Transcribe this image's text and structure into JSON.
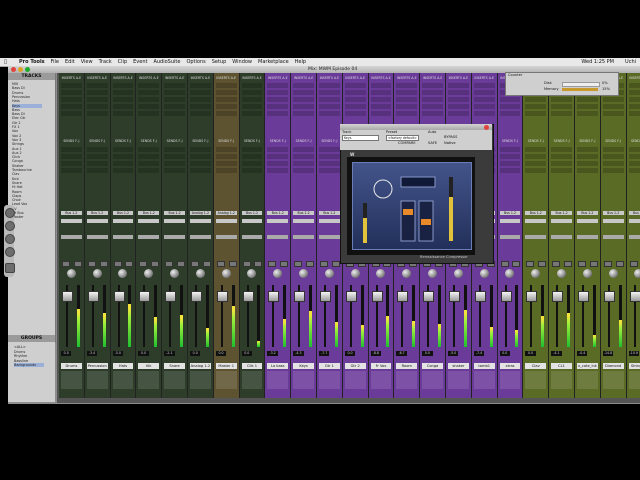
{
  "menu": {
    "app_name": "Pro Tools",
    "items": [
      "File",
      "Edit",
      "View",
      "Track",
      "Clip",
      "Event",
      "AudioSuite",
      "Options",
      "Setup",
      "Window",
      "Marketplace",
      "Help"
    ],
    "clock": "Wed 1:25 PM",
    "user": "Uchi"
  },
  "window": {
    "title": "Mix: MWM Episode 04"
  },
  "tracks_panel": {
    "title": "TRACKS",
    "rows": [
      "MIX",
      "Bass DI",
      "Drums",
      "Percussion",
      "Hats",
      "Keys",
      "Bass",
      "Bass DI",
      "Elec Gtr",
      "Gtr 2",
      "FX 1",
      "Vox",
      "Vox 2",
      "Vox 3",
      "Strings",
      "Aux 1",
      "Aux 2",
      "Click",
      "Conga",
      "Shaker",
      "Tambourine",
      "Clav",
      "Kick",
      "Snare",
      "Hi Hat",
      "Room",
      "Claps",
      "Choir",
      "Lead Vox",
      "BV",
      "FX Bus",
      "Master"
    ],
    "selected_index": 5
  },
  "groups_panel": {
    "title": "GROUPS",
    "rows": [
      "<ALL>",
      "Drums",
      "Rhythm",
      "Bassline",
      "Backgrounds"
    ],
    "selected_index": 4
  },
  "strips": [
    {
      "name": "Drums",
      "color": "#2d3d2a",
      "insert": "INSERTS A-E",
      "send": "SENDS F-J",
      "output": "Bus 1-2",
      "vol": "0.0",
      "meter": 0.62
    },
    {
      "name": "Percussion",
      "color": "#2d3d2a",
      "insert": "INSERTS A-E",
      "send": "SENDS F-J",
      "output": "Bus 1-2",
      "vol": "-3.4",
      "meter": 0.55
    },
    {
      "name": "Hats",
      "color": "#2d3d2a",
      "insert": "INSERTS A-E",
      "send": "SENDS F-J",
      "output": "Bus 1-2",
      "vol": "-5.0",
      "meter": 0.7
    },
    {
      "name": "Kik",
      "color": "#2d3d2a",
      "insert": "INSERTS A-E",
      "send": "SENDS F-J",
      "output": "Bus 1-2",
      "vol": "0.0",
      "meter": 0.48
    },
    {
      "name": "Snare",
      "color": "#2d3d2a",
      "insert": "INSERTS A-E",
      "send": "SENDS F-J",
      "output": "Bus 1-2",
      "vol": "-2.1",
      "meter": 0.52
    },
    {
      "name": "Analog 1-2",
      "color": "#2d3d2a",
      "insert": "INSERTS A-E",
      "send": "SENDS F-J",
      "output": "Analog 1-2",
      "vol": "0.0",
      "meter": 0.3
    },
    {
      "name": "Master 1",
      "color": "#5e5330",
      "insert": "INSERTS A-E",
      "send": "SENDS F-J",
      "output": "Analog 1-2",
      "vol": "0.0",
      "meter": 0.66
    },
    {
      "name": "Clik 1",
      "color": "#2d3d2a",
      "insert": "INSERTS A-E",
      "send": "SENDS F-J",
      "output": "Bus 1-2",
      "vol": "0.0",
      "meter": 0.1
    },
    {
      "name": "Lo bass",
      "color": "#6b3b9a",
      "insert": "INSERTS A-E",
      "send": "SENDS F-J",
      "output": "Bus 1-2",
      "vol": "-3.2",
      "meter": 0.45
    },
    {
      "name": "Keys",
      "color": "#6b3b9a",
      "insert": "INSERTS A-E",
      "send": "SENDS F-J",
      "output": "Bus 1-2",
      "vol": "-4.3",
      "meter": 0.58
    },
    {
      "name": "Gtr 1",
      "color": "#6b3b9a",
      "insert": "INSERTS A-E",
      "send": "SENDS F-J",
      "output": "Bus 1-2",
      "vol": "-7.7",
      "meter": 0.4
    },
    {
      "name": "Gtr 2",
      "color": "#6b3b9a",
      "insert": "INSERTS A-E",
      "send": "SENDS F-J",
      "output": "Bus 1-2",
      "vol": "0.0",
      "meter": 0.35
    },
    {
      "name": "Fr Vox",
      "color": "#6b3b9a",
      "insert": "INSERTS A-E",
      "send": "SENDS F-J",
      "output": "Bus 1-2",
      "vol": "-8.8",
      "meter": 0.5
    },
    {
      "name": "Room",
      "color": "#6b3b9a",
      "insert": "INSERTS A-E",
      "send": "SENDS F-J",
      "output": "Bus 1-2",
      "vol": "-6.7",
      "meter": 0.42
    },
    {
      "name": "Conga",
      "color": "#6b3b9a",
      "insert": "INSERTS A-E",
      "send": "SENDS F-J",
      "output": "Bus 1-2",
      "vol": "0.0",
      "meter": 0.37
    },
    {
      "name": "shaker",
      "color": "#6b3b9a",
      "insert": "INSERTS A-E",
      "send": "SENDS F-J",
      "output": "Bus 1-2",
      "vol": "-5.0",
      "meter": 0.6
    },
    {
      "name": "tamb1",
      "color": "#6b3b9a",
      "insert": "INSERTS A-E",
      "send": "SENDS F-J",
      "output": "Bus 1-2",
      "vol": "-7.4",
      "meter": 0.33
    },
    {
      "name": "xtras",
      "color": "#6b3b9a",
      "insert": "INSERTS A-E",
      "send": "SENDS F-J",
      "output": "Bus 1-2",
      "vol": "0.0",
      "meter": 0.28
    },
    {
      "name": "Clav",
      "color": "#5a6b25",
      "insert": "INSERTS A-E",
      "send": "SENDS F-J",
      "output": "Bus 1-2",
      "vol": "0.0",
      "meter": 0.5
    },
    {
      "name": "CL1",
      "color": "#5a6b25",
      "insert": "INSERTS A-E",
      "send": "SENDS F-J",
      "output": "Bus 1-2",
      "vol": "-4.1",
      "meter": 0.55
    },
    {
      "name": "x_cote_lnk",
      "color": "#5a6b25",
      "insert": "INSERTS A-E",
      "send": "SENDS F-J",
      "output": "Bus 1-2",
      "vol": "-0.4",
      "meter": 0.2
    },
    {
      "name": "Diamond",
      "color": "#5a6b25",
      "insert": "INSERTS A-E",
      "send": "SENDS F-J",
      "output": "Bus 1-2",
      "vol": "-14.8",
      "meter": 0.44
    },
    {
      "name": "String Pd",
      "color": "#5a6b25",
      "insert": "INSERTS A-E",
      "send": "SENDS F-J",
      "output": "Bus 1-2",
      "vol": "-10.9",
      "meter": 0.38
    }
  ],
  "plugin": {
    "title": "Track: Preset: Auto",
    "track_label": "Track",
    "preset_label": "Preset",
    "auto_label": "Auto",
    "track_value": "Keys",
    "preset_value": "<factory default>",
    "compare_label": "COMPARE",
    "bypass_label": "BYPASS",
    "safe_label": "SAFE",
    "native_label": "Native",
    "plugin_label": "Rennaissance Compressor",
    "brand_glyph": "W"
  },
  "mini_window": {
    "title": "Counter",
    "disk_label": "Disk",
    "mem_label": "Memory",
    "disk_pct": "0%",
    "mem_pct": "15%"
  },
  "colors": {
    "green_strip": "#2d3d2a",
    "purple_strip": "#6b3b9a",
    "olive_strip": "#5a6b25",
    "master_strip": "#5e5330",
    "meter_green": "#1fbf2f"
  }
}
